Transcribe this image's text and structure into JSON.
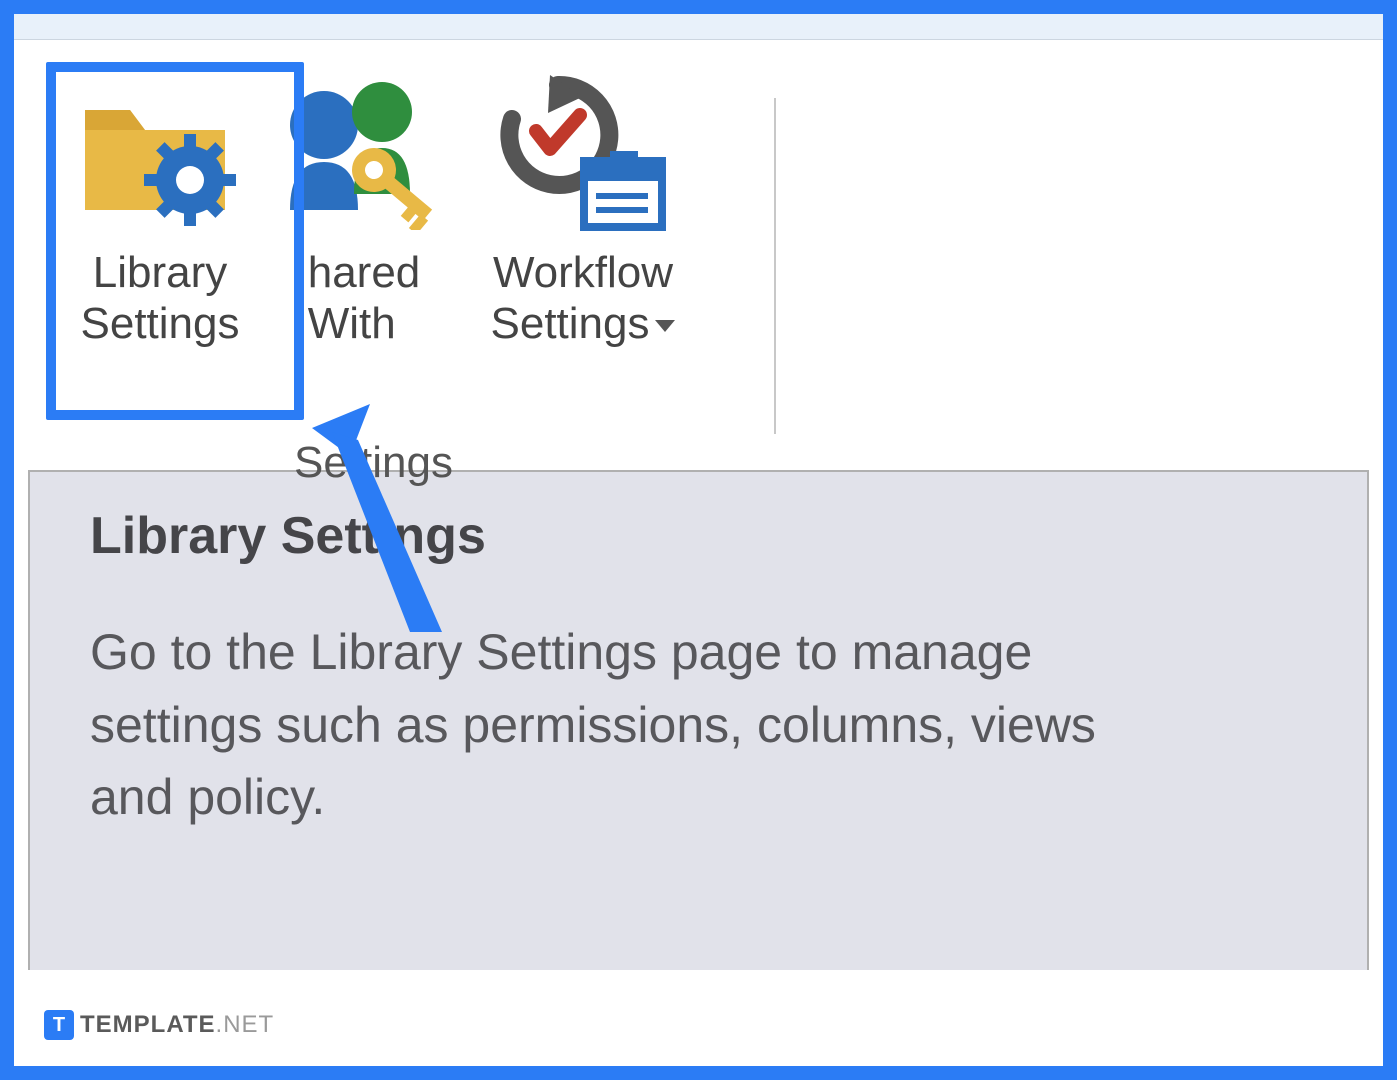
{
  "ribbon": {
    "buttons": [
      {
        "label_line1": "Library",
        "label_line2": "Settings"
      },
      {
        "label_line1": "hared",
        "label_line2": "With"
      },
      {
        "label_line1": "Workflow",
        "label_line2": "Settings"
      }
    ],
    "group_label": "Settings"
  },
  "tooltip": {
    "title": "Library Settings",
    "description": "Go to the Library Settings page to manage settings such as permissions, columns, views and policy."
  },
  "watermark": {
    "brand": "TEMPLATE",
    "suffix": ".NET"
  }
}
